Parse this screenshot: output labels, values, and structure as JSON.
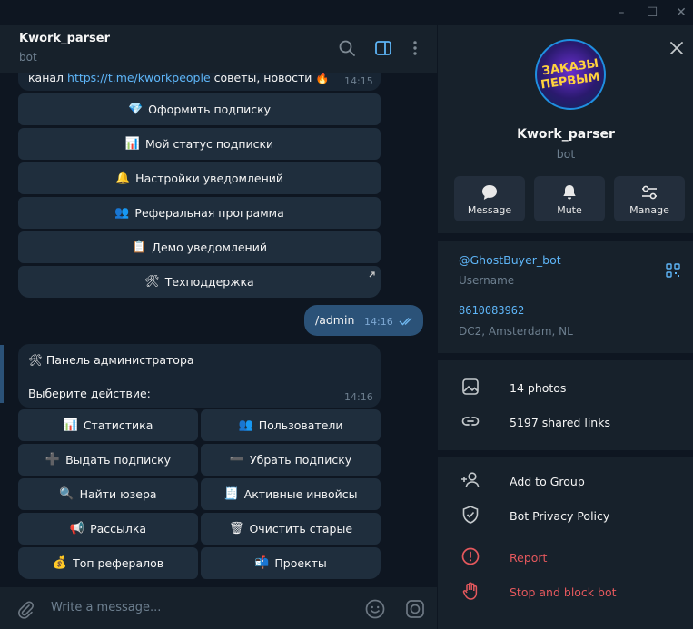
{
  "window": {
    "minimize": "–",
    "maximize": "☐",
    "close": "✕"
  },
  "chat": {
    "title": "Kwork_parser",
    "subtitle": "bot",
    "msg1": {
      "prefix": "канал ",
      "link": "https://t.me/kworkpeople",
      "suffix": "  советы, новости 🔥",
      "time": "14:15"
    },
    "keyboard1": [
      {
        "emoji": "💎",
        "label": "Оформить подписку"
      },
      {
        "emoji": "📊",
        "label": "Мой статус подписки"
      },
      {
        "emoji": "🔔",
        "label": "Настройки уведомлений"
      },
      {
        "emoji": "👥",
        "label": "Реферальная программа"
      },
      {
        "emoji": "📋",
        "label": "Демо уведомлений"
      },
      {
        "emoji": "🛠",
        "label": "Техподдержка"
      }
    ],
    "out": {
      "text": "/admin",
      "time": "14:16"
    },
    "msg2": {
      "title_emoji": "🛠",
      "title": "Панель администратора",
      "body": "Выберите действие:",
      "time": "14:16"
    },
    "keyboard2": [
      {
        "emoji": "📊",
        "label": "Статистика"
      },
      {
        "emoji": "👥",
        "label": "Пользователи"
      },
      {
        "emoji": "➕",
        "label": "Выдать подписку"
      },
      {
        "emoji": "➖",
        "label": "Убрать подписку"
      },
      {
        "emoji": "🔍",
        "label": "Найти юзера"
      },
      {
        "emoji": "🧾",
        "label": "Активные инвойсы"
      },
      {
        "emoji": "📢",
        "label": "Рассылка"
      },
      {
        "emoji": "🗑",
        "label": "Очистить старые"
      },
      {
        "emoji": "💰",
        "label": "Топ рефералов"
      },
      {
        "emoji": "📬",
        "label": "Проекты"
      }
    ],
    "composer_placeholder": "Write a message..."
  },
  "panel": {
    "avatar_line1": "ЗАКАЗЫ",
    "avatar_line2": "ПЕРВЫМ",
    "name": "Kwork_parser",
    "sub": "bot",
    "actions": [
      {
        "label": "Message",
        "icon": "message-icon"
      },
      {
        "label": "Mute",
        "icon": "bell-icon"
      },
      {
        "label": "Manage",
        "icon": "sliders-icon"
      }
    ],
    "username": "@GhostBuyer_bot",
    "username_label": "Username",
    "id": "8610083962",
    "dc": "DC2, Amsterdam, NL",
    "media": [
      {
        "label": "14 photos",
        "icon": "photo-icon"
      },
      {
        "label": "5197 shared links",
        "icon": "link-icon"
      }
    ],
    "extra": [
      {
        "label": "Add to Group",
        "icon": "add-user-icon"
      },
      {
        "label": "Bot Privacy Policy",
        "icon": "shield-icon"
      }
    ],
    "danger": [
      {
        "label": "Report",
        "icon": "report-icon"
      },
      {
        "label": "Stop and block bot",
        "icon": "hand-icon"
      }
    ],
    "colors": {
      "accent": "#5eb5f7",
      "danger": "#e4585d",
      "bg": "#17212b",
      "chat_bg": "#0e1621"
    }
  }
}
